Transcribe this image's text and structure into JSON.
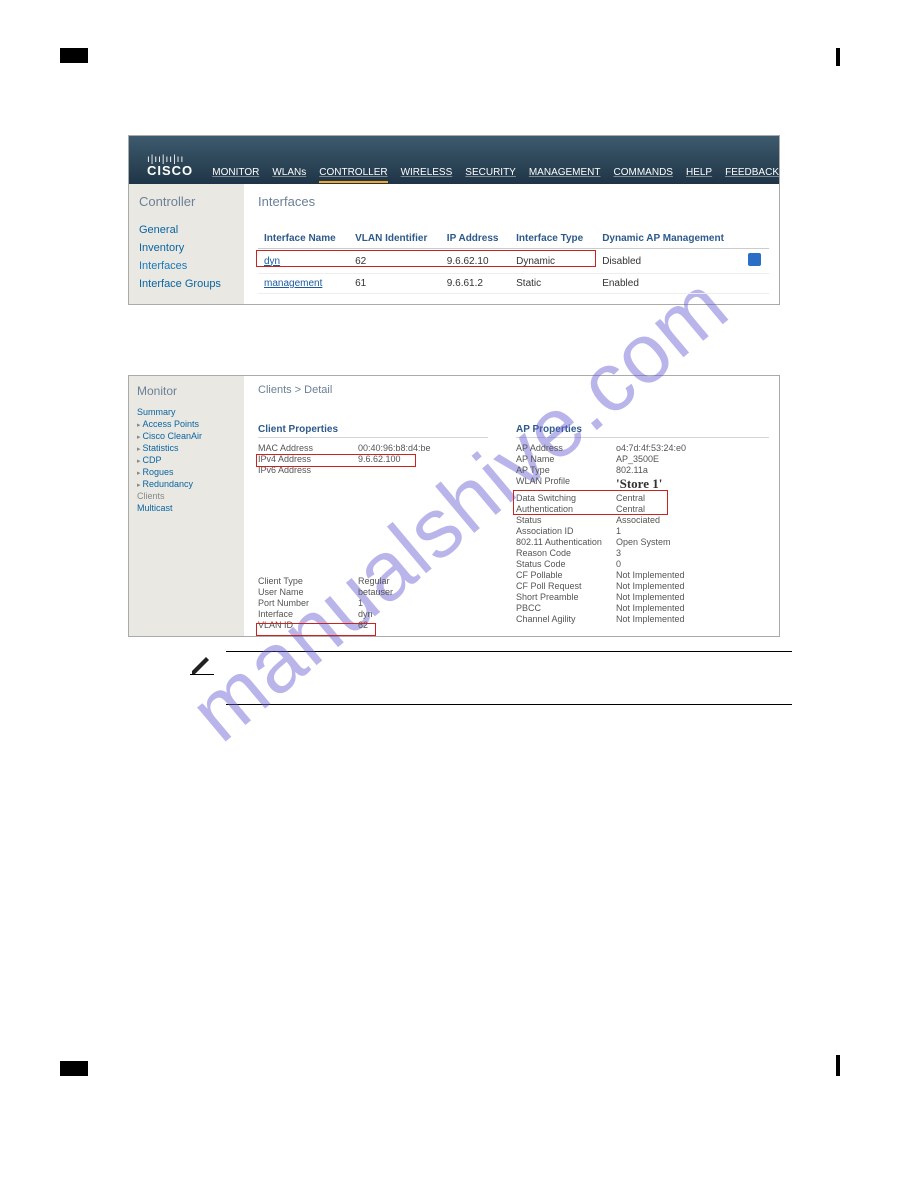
{
  "watermark": "manualshive.com",
  "cisco_nav": {
    "brand_bars": "ı|ıı|ıı|ıı",
    "brand_word": "CISCO",
    "items": [
      "MONITOR",
      "WLANs",
      "CONTROLLER",
      "WIRELESS",
      "SECURITY",
      "MANAGEMENT",
      "COMMANDS",
      "HELP",
      "FEEDBACK"
    ],
    "active_index": 2
  },
  "screenshot1": {
    "side_title": "Controller",
    "side_items": [
      "General",
      "Inventory",
      "Interfaces",
      "Interface Groups"
    ],
    "side_selected_index": 2,
    "page_title": "Interfaces",
    "columns": [
      "Interface Name",
      "VLAN Identifier",
      "IP Address",
      "Interface Type",
      "Dynamic AP Management"
    ],
    "rows": [
      {
        "name": "dyn",
        "vlan": "62",
        "ip": "9.6.62.10",
        "type": "Dynamic",
        "mgmt": "Disabled",
        "linked": true
      },
      {
        "name": "management",
        "vlan": "61",
        "ip": "9.6.61.2",
        "type": "Static",
        "mgmt": "Enabled",
        "linked": true
      }
    ]
  },
  "screenshot2": {
    "side_title": "Monitor",
    "side_items": [
      "Summary",
      "Access Points",
      "Cisco CleanAir",
      "Statistics",
      "CDP",
      "Rogues",
      "Redundancy",
      "Clients",
      "Multicast"
    ],
    "side_selected_index": 7,
    "page_title": "Clients > Detail",
    "client_properties_title": "Client Properties",
    "ap_properties_title": "AP Properties",
    "client_props_top": [
      {
        "k": "MAC Address",
        "v": "00:40:96:b8:d4:be"
      },
      {
        "k": "IPv4 Address",
        "v": "9.6.62.100"
      },
      {
        "k": "IPv6 Address",
        "v": ""
      }
    ],
    "client_props_bottom": [
      {
        "k": "Client Type",
        "v": "Regular"
      },
      {
        "k": "User Name",
        "v": "betauser"
      },
      {
        "k": "Port Number",
        "v": "1"
      },
      {
        "k": "Interface",
        "v": "dyn"
      },
      {
        "k": "VLAN ID",
        "v": "62"
      }
    ],
    "ap_props": [
      {
        "k": "AP Address",
        "v": "o4:7d:4f:53:24:e0"
      },
      {
        "k": "AP Name",
        "v": "AP_3500E"
      },
      {
        "k": "AP Type",
        "v": "802.11a"
      },
      {
        "k": "WLAN Profile",
        "v": "'Store 1'",
        "store": true
      },
      {
        "k": "Data Switching",
        "v": "Central"
      },
      {
        "k": "Authentication",
        "v": "Central"
      },
      {
        "k": "Status",
        "v": "Associated"
      },
      {
        "k": "Association ID",
        "v": "1"
      },
      {
        "k": "802.11 Authentication",
        "v": "Open System"
      },
      {
        "k": "Reason Code",
        "v": "3"
      },
      {
        "k": "Status Code",
        "v": "0"
      },
      {
        "k": "CF Pollable",
        "v": "Not Implemented"
      },
      {
        "k": "CF Poll Request",
        "v": "Not Implemented"
      },
      {
        "k": "Short Preamble",
        "v": "Not Implemented"
      },
      {
        "k": "PBCC",
        "v": "Not Implemented"
      },
      {
        "k": "Channel Agility",
        "v": "Not Implemented"
      }
    ]
  },
  "note": {
    "label": "Note"
  }
}
